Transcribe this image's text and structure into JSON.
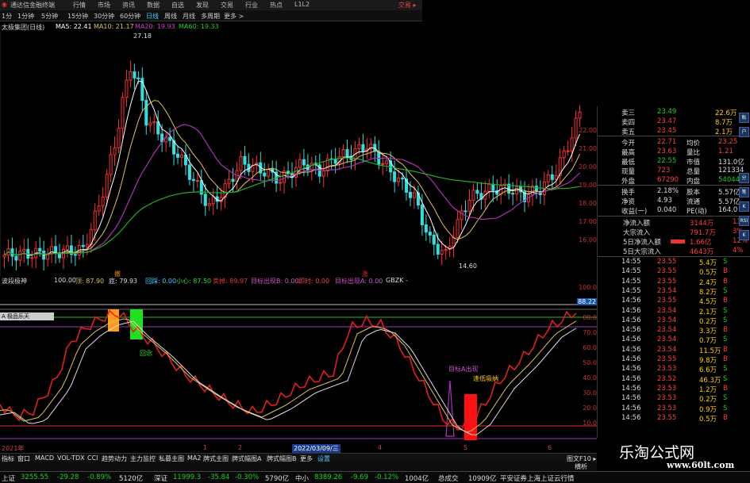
{
  "titlebar": {
    "app_name": "通达信金融终端",
    "menu": [
      "行情",
      "市场",
      "资讯",
      "数据",
      "自选",
      "发现",
      "交易",
      "行业",
      "热点",
      "L1L2"
    ],
    "trade_label": "交易 ▸"
  },
  "timebar": {
    "periods": [
      "1分",
      "1分钟",
      "5分钟",
      "15分钟",
      "30分钟",
      "60分钟",
      "日线",
      "周线",
      "月线",
      "多周期",
      "更多 >"
    ]
  },
  "ma_legend": {
    "stock": "太极集团(日线)",
    "ma5": "MA5: 22.41",
    "ma10": "MA10: 21.17",
    "ma20": "MA20: 19.93",
    "ma60": "MA60: 19.33"
  },
  "price_labels": {
    "high": "27.18",
    "low": "14.60"
  },
  "price_axis": [
    "22.00",
    "21.00",
    "20.00",
    "19.00",
    "18.00",
    "17.00",
    "16.00"
  ],
  "indicator_legend": {
    "name": "波段极神",
    "v1": "100.00",
    "v2": "顶: 87.90",
    "v3": "底: 79.93",
    "v4": "回踩: 0.00",
    "v5": "小心: 87.50",
    "v6": "卖掉: 89.97",
    "v7": "目标出现B: 0.00",
    "v8": "即时: 0.00",
    "v9": "目标出现A: 0.00",
    "v10": "GBZK -"
  },
  "indicator_axis": [
    "100.0",
    "88.22",
    "80.0",
    "70.0",
    "60.0",
    "50.0",
    "40.0",
    "30.0",
    "20.0",
    "10.0"
  ],
  "indicator_notes": {
    "sell": "撤",
    "buy": "涨",
    "back": "回念",
    "targetA": "目标A出现",
    "chase": "逢低吸纳"
  },
  "subpanel_tab": "A 极品乐天",
  "time_axis": [
    "2021年",
    "1",
    "2",
    "2022/03/09/三",
    "4",
    "5",
    "6"
  ],
  "bottom_tabs": [
    "指标",
    "窗口",
    "MACD",
    "VOL-TDX",
    "CCI",
    "趋势动力",
    "主力监控",
    "私募主图",
    "MA2",
    "牌式主图",
    "牌式幅图A",
    "牌式幅图B",
    "更多",
    "设置"
  ],
  "bottom_right": "图文F10 ▸",
  "mode_label": "横析",
  "quote": {
    "sell": [
      {
        "label": "卖三",
        "price": "23.49",
        "vol": "22.6万"
      },
      {
        "label": "卖四",
        "price": "23.47",
        "vol": "8.7万"
      },
      {
        "label": "卖五",
        "price": "23.45",
        "vol": "2.1万"
      }
    ],
    "stats": [
      {
        "l1": "今开",
        "v1": "22.71",
        "l2": "均价",
        "v2": "23.25"
      },
      {
        "l1": "最高",
        "v1": "23.63",
        "l2": "量比",
        "v2": "1.21"
      },
      {
        "l1": "最低",
        "v1": "22.55",
        "l2": "市值",
        "v2": "131.0亿"
      },
      {
        "l1": "现量",
        "v1": "723",
        "l2": "总量",
        "v2": "121334"
      },
      {
        "l1": "外盘",
        "v1": "67290",
        "l2": "内盘",
        "v2": "54044"
      },
      {
        "l1": "换手",
        "v1": "2.18%",
        "l2": "股本",
        "v2": "5.57亿"
      },
      {
        "l1": "净资",
        "v1": "4.93",
        "l2": "流通",
        "v2": "5.57亿"
      },
      {
        "l1": "收益(一)",
        "v1": "0.040",
        "l2": "PE(动)",
        "v2": "164.0"
      }
    ],
    "flows": [
      {
        "label": "净流入额",
        "value": "3144万",
        "pct": "11%"
      },
      {
        "label": "大宗流入",
        "value": "791.7万",
        "pct": "3%"
      },
      {
        "label": "5日净流入额",
        "value": "1.66亿",
        "pct": "12%"
      },
      {
        "label": "5日大宗流入",
        "value": "4643万",
        "pct": "4%"
      }
    ],
    "ticks": [
      {
        "t": "14:55",
        "p": "23.55",
        "v": "5.4万",
        "d": "S"
      },
      {
        "t": "14:55",
        "p": "23.55",
        "v": "0.5万",
        "d": "B"
      },
      {
        "t": "14:55",
        "p": "23.55",
        "v": "2.4万",
        "d": "B"
      },
      {
        "t": "14:55",
        "p": "23.54",
        "v": "8.2万",
        "d": "S"
      },
      {
        "t": "14:56",
        "p": "23.55",
        "v": "4.5万",
        "d": "B"
      },
      {
        "t": "14:56",
        "p": "23.54",
        "v": "2.1万",
        "d": "S"
      },
      {
        "t": "14:56",
        "p": "23.54",
        "v": "0.2万",
        "d": "S"
      },
      {
        "t": "14:56",
        "p": "23.54",
        "v": "3.3万",
        "d": "B"
      },
      {
        "t": "14:56",
        "p": "23.54",
        "v": "0.7万",
        "d": "S"
      },
      {
        "t": "14:56",
        "p": "23.54",
        "v": "11.5万",
        "d": "B"
      },
      {
        "t": "14:56",
        "p": "23.55",
        "v": "9.8万",
        "d": "B"
      },
      {
        "t": "14:56",
        "p": "23.53",
        "v": "6.6万",
        "d": "S"
      },
      {
        "t": "14:56",
        "p": "23.52",
        "v": "46.3万",
        "d": "S"
      },
      {
        "t": "14:56",
        "p": "23.53",
        "v": "1.2万",
        "d": "B"
      },
      {
        "t": "14:56",
        "p": "23.53",
        "v": "0.2万",
        "d": "S"
      },
      {
        "t": "14:56",
        "p": "23.53",
        "v": "0.9万",
        "d": "S"
      },
      {
        "t": "14:56",
        "p": "23.55",
        "v": "0.5万",
        "d": "B"
      }
    ]
  },
  "side_icons": [
    "账",
    "户",
    "分",
    "笔",
    "K",
    "RSI",
    "K"
  ],
  "statusbar": {
    "sh_label": "上证",
    "sh_val": "3255.55",
    "sh_chg": "-29.28",
    "sh_pct": "-0.89%",
    "sh_amt": "5120亿",
    "sz_label": "深证",
    "sz_val": "11999.3",
    "sz_chg": "-35.84",
    "sz_pct": "-0.30%",
    "sz_amt": "5790亿",
    "zx_label": "中小",
    "zx_val": "8389.26",
    "zx_chg": "-9.69",
    "zx_pct": "-0.12%",
    "zx_amt": "1004亿",
    "total_label": "总成交",
    "total_val": "10909亿",
    "ticker": "平安证券上海上证云行情"
  },
  "watermark": {
    "title": "乐淘公式网",
    "url": "www.60lt.com"
  },
  "colors": {
    "up": "#ff3030",
    "down": "#30e0e0",
    "ma5": "#ffffff",
    "ma10": "#e0c060",
    "ma20": "#c040c0",
    "ma60": "#20c020"
  },
  "chart_data": {
    "type": "candlestick",
    "title": "太极集团(日线)",
    "ylim": [
      14,
      28
    ],
    "high": 27.18,
    "low": 14.6,
    "ma": {
      "MA5": 22.41,
      "MA10": 21.17,
      "MA20": 19.93,
      "MA60": 19.33
    }
  }
}
